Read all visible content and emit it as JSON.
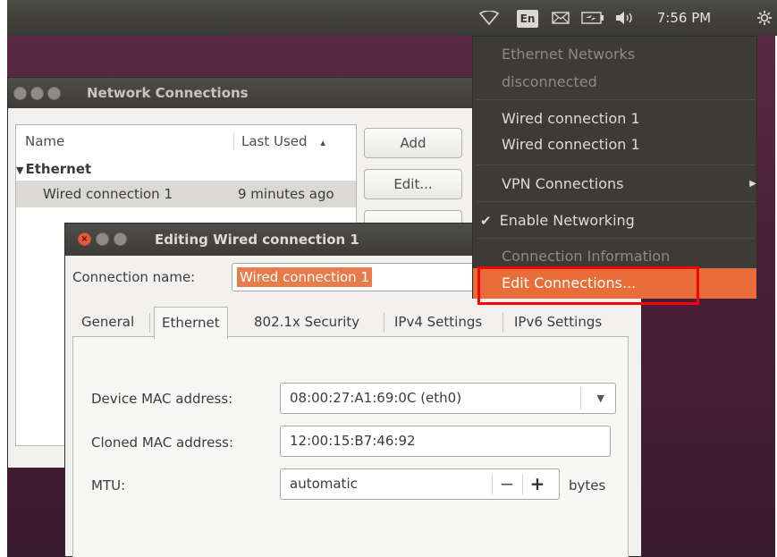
{
  "top_panel": {
    "lang_badge": "En",
    "clock": "7:56 PM",
    "icons": [
      "network-wireless-icon",
      "mail-icon",
      "battery-icon",
      "volume-icon",
      "settings-gear-icon"
    ]
  },
  "nc_window": {
    "title": "Network Connections",
    "columns": [
      "Name",
      "Last Used"
    ],
    "sort_indicator": "▴",
    "group_label": "Ethernet",
    "row": {
      "name": "Wired connection 1",
      "last_used": "9 minutes ago"
    },
    "buttons": {
      "add": "Add",
      "edit": "Edit..."
    }
  },
  "edit_window": {
    "title": "Editing Wired connection 1",
    "connection_name_label": "Connection name:",
    "connection_name_value": "Wired connection 1",
    "tabs": [
      "General",
      "Ethernet",
      "802.1x Security",
      "IPv4 Settings",
      "IPv6 Settings"
    ],
    "active_tab": "Ethernet",
    "device_mac_label": "Device MAC address:",
    "device_mac_value": "08:00:27:A1:69:0C (eth0)",
    "cloned_mac_label": "Cloned MAC address:",
    "cloned_mac_value": "12:00:15:B7:46:92",
    "mtu_label": "MTU:",
    "mtu_value": "automatic",
    "mtu_unit": "bytes",
    "minus": "−",
    "plus": "+"
  },
  "net_menu": {
    "header": "Ethernet Networks",
    "status": "disconnected",
    "items": [
      "Wired connection 1",
      "Wired connection 1"
    ],
    "vpn": "VPN Connections",
    "enable_networking": "Enable Networking",
    "checkmark": "✔",
    "connection_info": "Connection Information",
    "edit_connections": "Edit Connections..."
  },
  "colors": {
    "accent_orange": "#e96d38",
    "highlight_red": "#ff0000",
    "panel_dark": "#3c3b37"
  }
}
